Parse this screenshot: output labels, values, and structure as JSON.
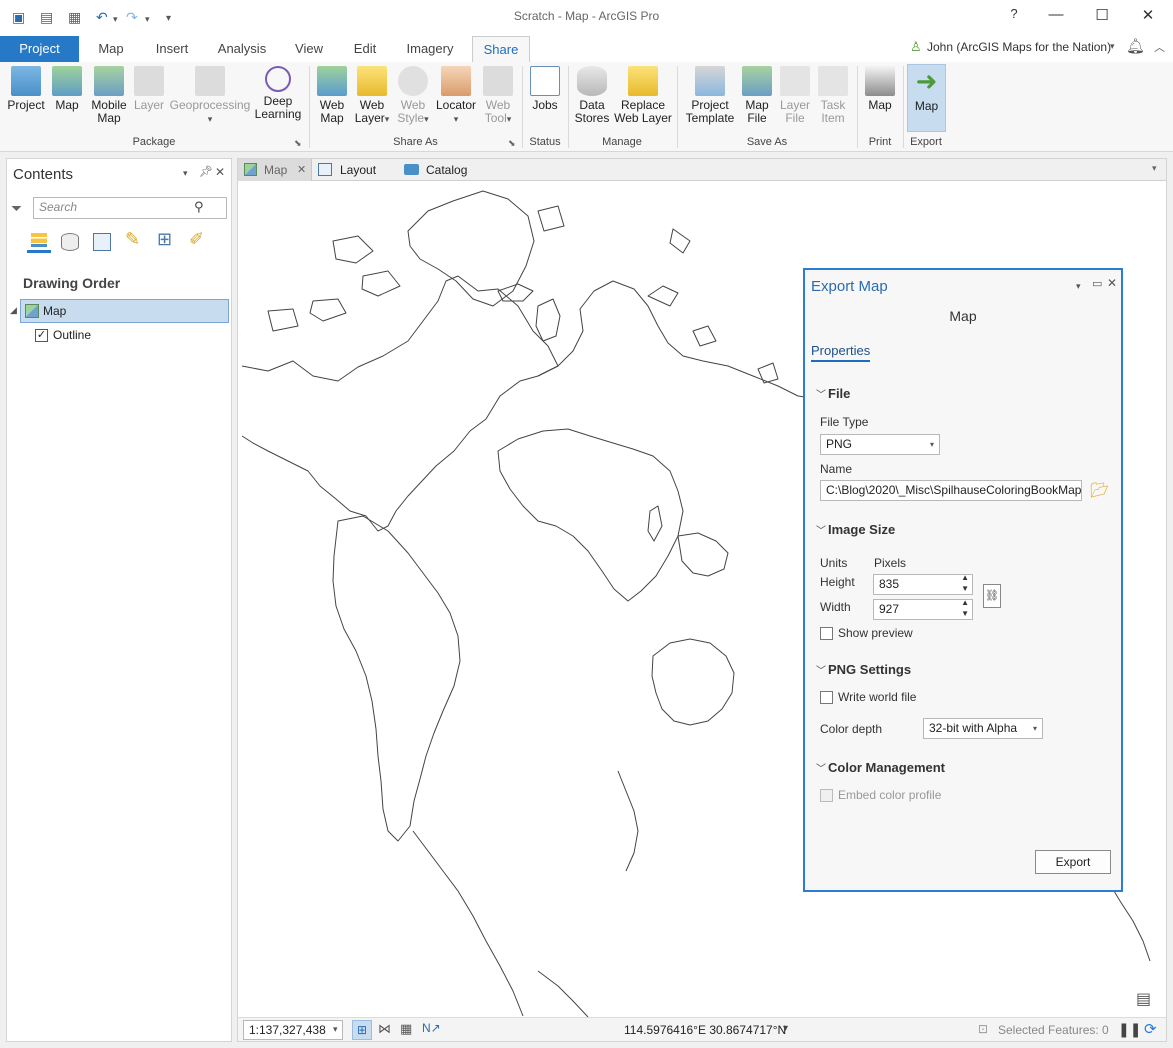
{
  "window": {
    "title": "Scratch - Map - ArcGIS Pro"
  },
  "tabs": [
    "Project",
    "Map",
    "Insert",
    "Analysis",
    "View",
    "Edit",
    "Imagery",
    "Share"
  ],
  "user": "John (ArcGIS Maps for the Nation)",
  "ribbon": {
    "package": {
      "label": "Package",
      "items": [
        "Project",
        "Map",
        "Mobile Map",
        "Layer",
        "Geoprocessing",
        "Deep Learning"
      ]
    },
    "share_as": {
      "label": "Share As",
      "items": [
        "Web Map",
        "Web Layer",
        "Web Style",
        "Locator",
        "Web Tool"
      ]
    },
    "status": {
      "label": "Status",
      "items": [
        "Jobs"
      ]
    },
    "manage": {
      "label": "Manage",
      "items": [
        "Data Stores",
        "Replace Web Layer"
      ]
    },
    "save_as": {
      "label": "Save As",
      "items": [
        "Project Template",
        "Map File",
        "Layer File",
        "Task Item"
      ]
    },
    "print": {
      "label": "Print",
      "items": [
        "Map"
      ]
    },
    "export": {
      "label": "Export",
      "items": [
        "Map"
      ]
    }
  },
  "contents": {
    "title": "Contents",
    "search_placeholder": "Search",
    "section": "Drawing Order",
    "layers": [
      {
        "name": "Map"
      },
      {
        "name": "Outline"
      }
    ]
  },
  "view_tabs": [
    "Map",
    "Layout",
    "Catalog"
  ],
  "status": {
    "scale": "1:137,327,438",
    "coords": "114.5976416°E 30.8674717°N",
    "selected": "Selected Features: 0"
  },
  "export_dialog": {
    "title": "Export Map",
    "subtitle": "Map",
    "tab": "Properties",
    "file_header": "File",
    "file_type_label": "File Type",
    "file_type": "PNG",
    "name_label": "Name",
    "name_value": "C:\\Blog\\2020\\_Misc\\SpilhauseColoringBookMap",
    "image_size_header": "Image Size",
    "units_label": "Units",
    "units_value": "Pixels",
    "height_label": "Height",
    "height_value": "835",
    "width_label": "Width",
    "width_value": "927",
    "show_preview": "Show preview",
    "png_header": "PNG Settings",
    "write_world": "Write world file",
    "color_depth_label": "Color depth",
    "color_depth_value": "32-bit with Alpha",
    "color_mgmt_header": "Color Management",
    "embed_profile": "Embed color profile",
    "export_button": "Export"
  },
  "colors": {
    "accent": "#2679c7",
    "selected": "#c7dcef"
  }
}
